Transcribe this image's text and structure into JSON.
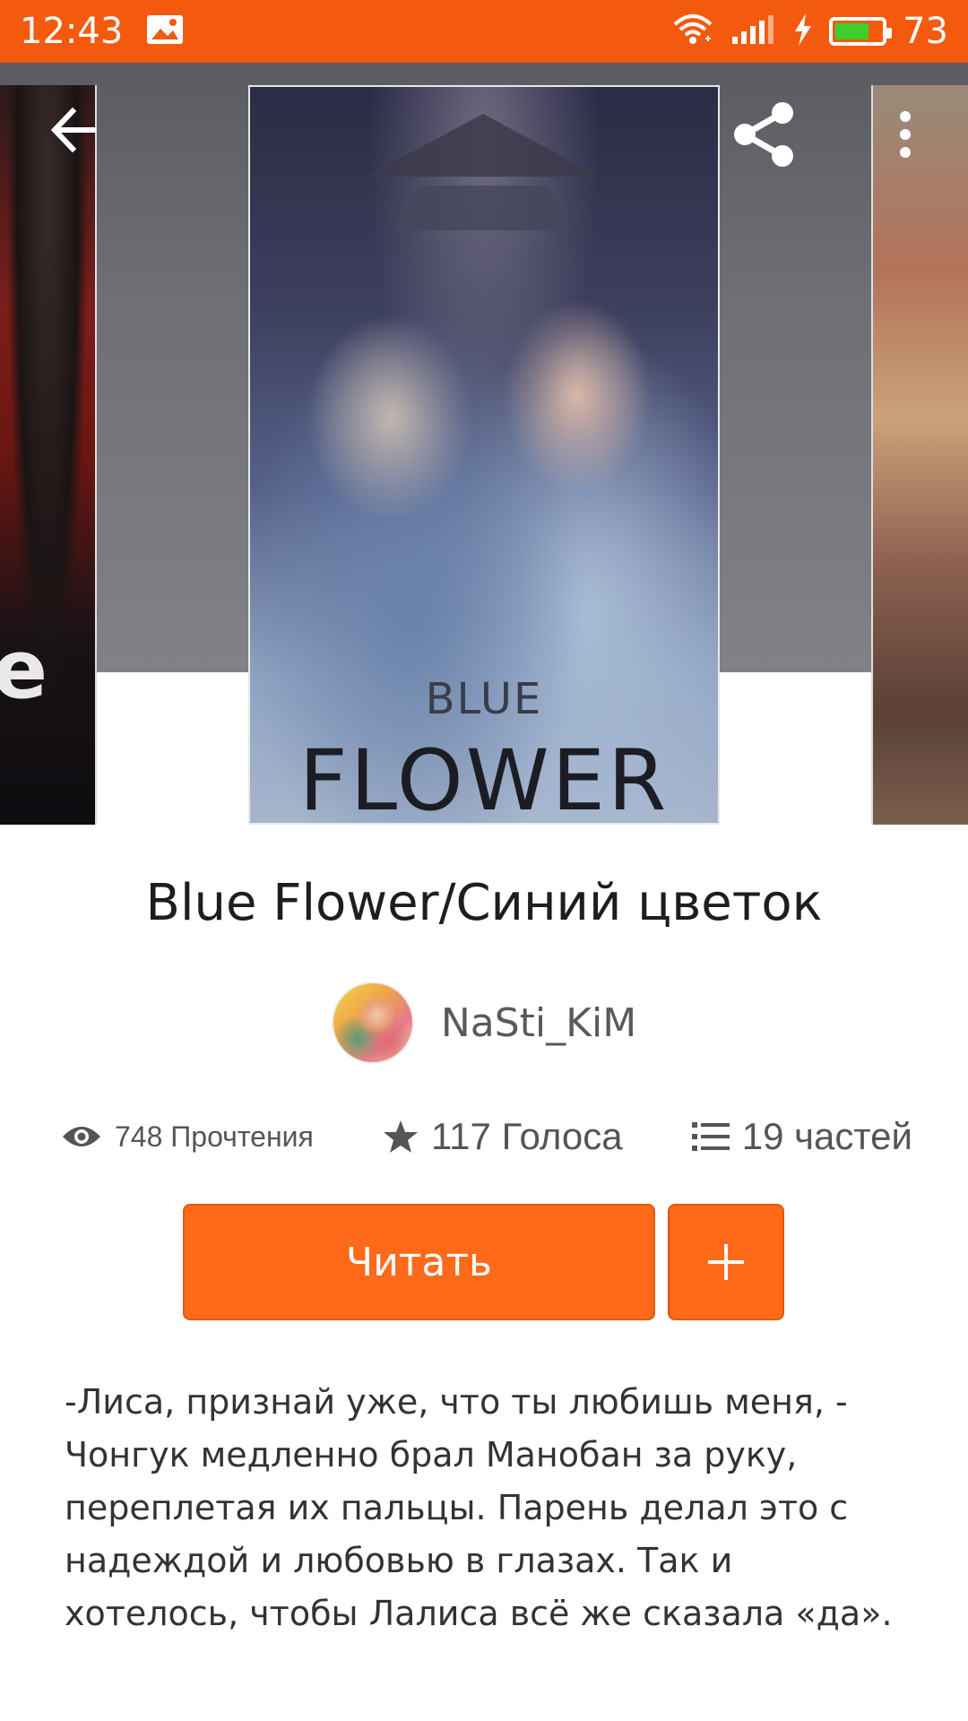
{
  "status_bar": {
    "time": "12:43",
    "battery_percent": "73",
    "battery_level": 0.73
  },
  "hero": {
    "cover_title_small": "BLUE",
    "cover_title_big": "FLOWER",
    "left_cover_text": "e"
  },
  "book": {
    "title": "Blue Flower/Синий цветок",
    "author": "NaSti_KiM",
    "stats": {
      "reads": "748 Прочтения",
      "votes": "117 Голоса",
      "parts": "19 частей"
    },
    "read_label": "Читать",
    "add_label": "+",
    "description": "-Лиса, признай уже, что ты любишь меня, - Чонгук медленно брал Манобан за руку, переплетая их пальцы. Парень делал это с надеждой и любовью в глазах. Так и хотелось, чтобы Лалиса всё же сказала «да»."
  },
  "colors": {
    "accent": "#ff6a1a",
    "status_bar": "#f45a0e"
  },
  "icons": [
    "image-icon",
    "wifi-icon",
    "signal-icon",
    "charging-icon",
    "battery-icon",
    "back-arrow-icon",
    "share-icon",
    "more-vert-icon",
    "eye-icon",
    "star-icon",
    "list-icon",
    "plus-icon"
  ]
}
